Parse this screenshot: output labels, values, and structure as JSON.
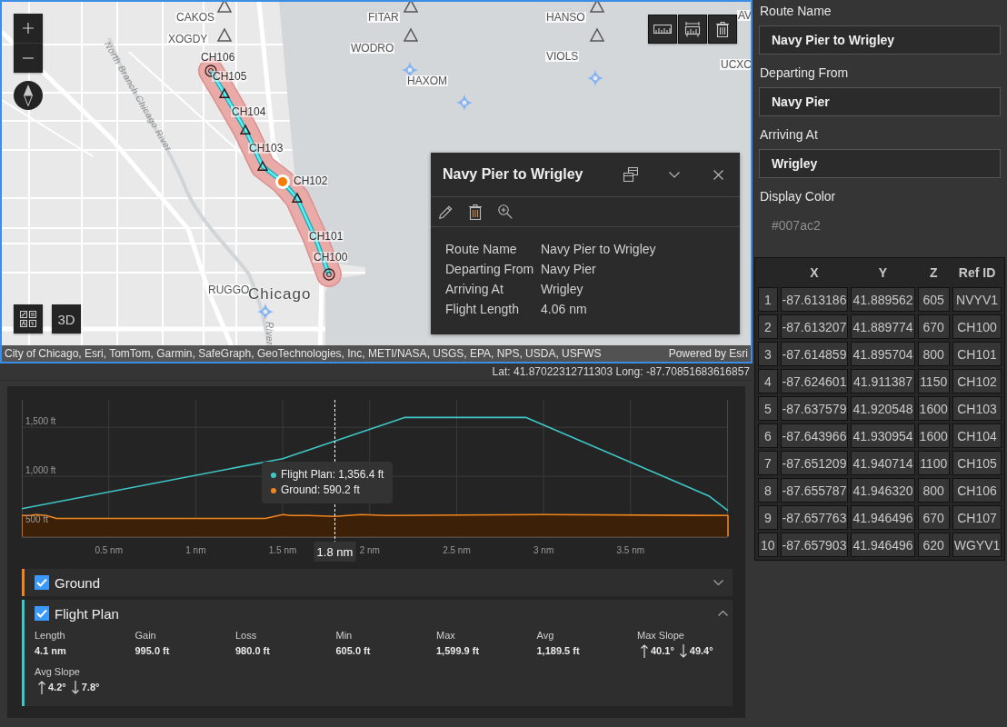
{
  "map": {
    "labels": [
      {
        "text": "CAKOS",
        "kind": "fix"
      },
      {
        "text": "XOGDY",
        "kind": "fix"
      },
      {
        "text": "FITAR",
        "kind": "fix"
      },
      {
        "text": "WODRO",
        "kind": "fix"
      },
      {
        "text": "HANSO",
        "kind": "fix"
      },
      {
        "text": "VIOLS",
        "kind": "fix"
      },
      {
        "text": "HAXOM",
        "kind": "fix"
      },
      {
        "text": "UCXC",
        "kind": "fix"
      },
      {
        "text": "AV",
        "kind": "fix"
      },
      {
        "text": "North Branch Chicago River",
        "kind": "river"
      },
      {
        "text": "CH106",
        "kind": "checkpoint"
      },
      {
        "text": "CH105",
        "kind": "checkpoint"
      },
      {
        "text": "CH104",
        "kind": "checkpoint"
      },
      {
        "text": "CH103",
        "kind": "checkpoint"
      },
      {
        "text": "CH102",
        "kind": "checkpoint"
      },
      {
        "text": "CH101",
        "kind": "checkpoint"
      },
      {
        "text": "CH100",
        "kind": "checkpoint"
      },
      {
        "text": "RUGGO",
        "kind": "fix"
      },
      {
        "text": "Chicago",
        "kind": "city"
      },
      {
        "text": "River",
        "kind": "river"
      }
    ],
    "view_button": "3D",
    "attribution": "City of Chicago, Esri, TomTom, Garmin, SafeGraph, GeoTechnologies, Inc, METI/NASA, USGS, EPA, NPS, USDA, USFWS",
    "powered_by": "Powered by Esri",
    "popup": {
      "title": "Navy Pier to Wrigley",
      "fields": [
        {
          "label": "Route Name",
          "value": "Navy Pier to Wrigley"
        },
        {
          "label": "Departing From",
          "value": "Navy Pier"
        },
        {
          "label": "Arriving At",
          "value": "Wrigley"
        },
        {
          "label": "Flight Length",
          "value": "4.06 nm"
        }
      ]
    }
  },
  "coordinates": "Lat: 41.87022312711303 Long: -87.70851683616857",
  "profile": {
    "chart_data": [
      {
        "type": "line",
        "xlim": [
          0,
          4.06
        ],
        "ylim": [
          380,
          1780
        ],
        "xticks": [
          {
            "value": 0.5,
            "label": "0.5 nm"
          },
          {
            "value": 1,
            "label": "1 nm"
          },
          {
            "value": 1.5,
            "label": "1.5 nm"
          },
          {
            "value": 2,
            "label": "2 nm"
          },
          {
            "value": 2.5,
            "label": "2.5 nm"
          },
          {
            "value": 3,
            "label": "3 nm"
          },
          {
            "value": 3.5,
            "label": "3.5 nm"
          }
        ],
        "yticks": [
          {
            "value": 500,
            "label": "500 ft"
          },
          {
            "value": 1000,
            "label": "1,000 ft"
          },
          {
            "value": 1500,
            "label": "1,500 ft"
          }
        ],
        "grid": true,
        "series": [
          {
            "type": "area",
            "color": "#f0851f",
            "x": [
              0,
              0.05,
              0.08,
              0.14,
              0.2,
              1.4,
              1.5,
              1.55,
              1.65,
              1.8,
              1.95,
              2.1,
              3.0,
              4.06
            ],
            "values": [
              600,
              600,
              610,
              600,
              570,
              570,
              610,
              600,
              600,
              590,
              610,
              600,
              610,
              600
            ]
          },
          {
            "type": "line",
            "color": "#3fc7c7",
            "x": [
              0,
              1.5,
              2.2,
              2.9,
              3.95,
              4.06
            ],
            "values": [
              670,
              1180,
              1600,
              1600,
              800,
              650
            ]
          }
        ],
        "ref_lines": [
          {
            "axis": "x",
            "value": 1.8,
            "label": "1.8 nm",
            "color": "#ffffff",
            "line_style": "dashed"
          }
        ]
      }
    ],
    "tooltip": [
      {
        "text": "Flight Plan: 1,356.4 ft",
        "color": "#3fc7c7"
      },
      {
        "text": "Ground: 590.2 ft",
        "color": "#f0851f"
      }
    ],
    "layers": [
      {
        "name": "Ground",
        "checked": true,
        "expanded": false,
        "color": "#f0851f"
      },
      {
        "name": "Flight Plan",
        "checked": true,
        "expanded": true,
        "color": "#3fc7c7",
        "stats": [
          {
            "label": "Length",
            "kind": "value",
            "value": "4.1 nm"
          },
          {
            "label": "Gain",
            "kind": "value",
            "value": "995.0 ft"
          },
          {
            "label": "Loss",
            "kind": "value",
            "value": "980.0 ft"
          },
          {
            "label": "Min",
            "kind": "value",
            "value": "605.0 ft"
          },
          {
            "label": "Max",
            "kind": "value",
            "value": "1,599.9 ft"
          },
          {
            "label": "Avg",
            "kind": "value",
            "value": "1,189.5 ft"
          },
          {
            "label": "Max Slope",
            "kind": "slope",
            "up": "40.1°",
            "down": "49.4°"
          },
          {
            "label": "Avg Slope",
            "kind": "slope",
            "up": "4.2°",
            "down": "7.8°"
          }
        ]
      }
    ]
  },
  "form": {
    "fields": [
      {
        "label": "Route Name",
        "value": "Navy Pier to Wrigley",
        "kind": "text"
      },
      {
        "label": "Departing From",
        "value": "Navy Pier",
        "kind": "text"
      },
      {
        "label": "Arriving At",
        "value": "Wrigley",
        "kind": "text"
      },
      {
        "label": "Display Color",
        "placeholder": "#007ac2",
        "kind": "color"
      }
    ]
  },
  "table": {
    "columns": [
      "X",
      "Y",
      "Z",
      "Ref ID"
    ],
    "rows": [
      {
        "number": "1",
        "cells": [
          "-87.613186",
          "41.889562",
          "605",
          "NVYV1"
        ]
      },
      {
        "number": "2",
        "cells": [
          "-87.613207",
          "41.889774",
          "670",
          "CH100"
        ]
      },
      {
        "number": "3",
        "cells": [
          "-87.614859",
          "41.895704",
          "800",
          "CH101"
        ]
      },
      {
        "number": "4",
        "cells": [
          "-87.624601",
          "41.911387",
          "1150",
          "CH102"
        ]
      },
      {
        "number": "5",
        "cells": [
          "-87.637579",
          "41.920548",
          "1600",
          "CH103"
        ]
      },
      {
        "number": "6",
        "cells": [
          "-87.643966",
          "41.930954",
          "1600",
          "CH104"
        ]
      },
      {
        "number": "7",
        "cells": [
          "-87.651209",
          "41.940714",
          "1100",
          "CH105"
        ]
      },
      {
        "number": "8",
        "cells": [
          "-87.655787",
          "41.946320",
          "800",
          "CH106"
        ]
      },
      {
        "number": "9",
        "cells": [
          "-87.657763",
          "41.946496",
          "670",
          "CH107"
        ]
      },
      {
        "number": "10",
        "cells": [
          "-87.657903",
          "41.946496",
          "620",
          "WGYV1"
        ]
      }
    ]
  }
}
